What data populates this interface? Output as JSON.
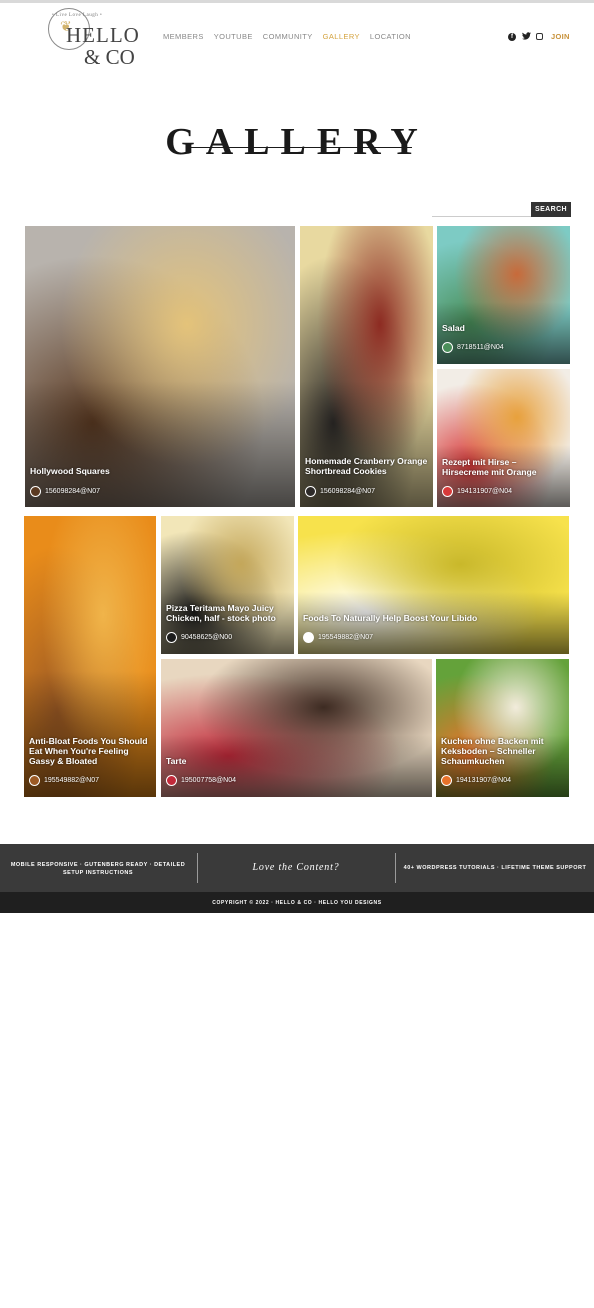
{
  "header": {
    "logo": {
      "ring_text": "• Live Love Laugh •",
      "line1": "HELLO",
      "line2": "& CO"
    },
    "nav": [
      {
        "label": "MEMBERS"
      },
      {
        "label": "YOUTUBE"
      },
      {
        "label": "COMMUNITY"
      },
      {
        "label": "GALLERY",
        "active": true
      },
      {
        "label": "LOCATION"
      }
    ],
    "social": {
      "join_label": "JOIN"
    }
  },
  "page": {
    "title": "GALLERY"
  },
  "search": {
    "placeholder": "",
    "button_label": "SEARCH"
  },
  "gallery": [
    {
      "caption": "Hollywood Squares",
      "author": "156098284@N07",
      "colors": [
        "#b8b3ad",
        "#5b3a22",
        "#e4c37a"
      ]
    },
    {
      "caption": "Homemade Cranberry Orange Shortbread Cookies",
      "author": "156098284@N07",
      "colors": [
        "#e8d9a0",
        "#2d2a28",
        "#8d2b22"
      ]
    },
    {
      "caption": "Salad",
      "author": "8718511@N04",
      "colors": [
        "#7dcbc4",
        "#4a8f5a",
        "#c86a3a"
      ]
    },
    {
      "caption": "Rezept mit Hirse – Hirsecreme mit Orange",
      "author": "194131907@N04",
      "colors": [
        "#f2ede6",
        "#d83a3a",
        "#e8a13c"
      ]
    },
    {
      "caption": "Anti-Bloat Foods You Should Eat When You're Feeling Gassy & Bloated",
      "author": "195549882@N07",
      "colors": [
        "#e98c1a",
        "#9c5a24",
        "#f0b44a"
      ]
    },
    {
      "caption": "Pizza Teritama Mayo Juicy Chicken, half - stock photo",
      "author": "90458625@N00",
      "colors": [
        "#f2e6b8",
        "#1c1c1c",
        "#c4a75a"
      ]
    },
    {
      "caption": "Foods To Naturally Help Boost Your Libido",
      "author": "195549882@N07",
      "colors": [
        "#f7e24c",
        "#ffffff",
        "#c9b82a"
      ]
    },
    {
      "caption": "Tarte",
      "author": "195007758@N04",
      "colors": [
        "#e8d7c0",
        "#c2293a",
        "#3d2b22"
      ]
    },
    {
      "caption": "Kuchen ohne Backen mit Keksboden – Schneller Schaumkuchen",
      "author": "194131907@N04",
      "colors": [
        "#64a23a",
        "#e8722a",
        "#f2ecdc"
      ]
    }
  ],
  "footer": {
    "left": "MOBILE RESPONSIVE · GUTENBERG READY · DETAILED SETUP INSTRUCTIONS",
    "middle": "Love the Content?",
    "right": "40+ WORDPRESS TUTORIALS · LIFETIME THEME SUPPORT",
    "copyright": "COPYRIGHT © 2022 · HELLO & CO · HELLO YOU DESIGNS"
  }
}
